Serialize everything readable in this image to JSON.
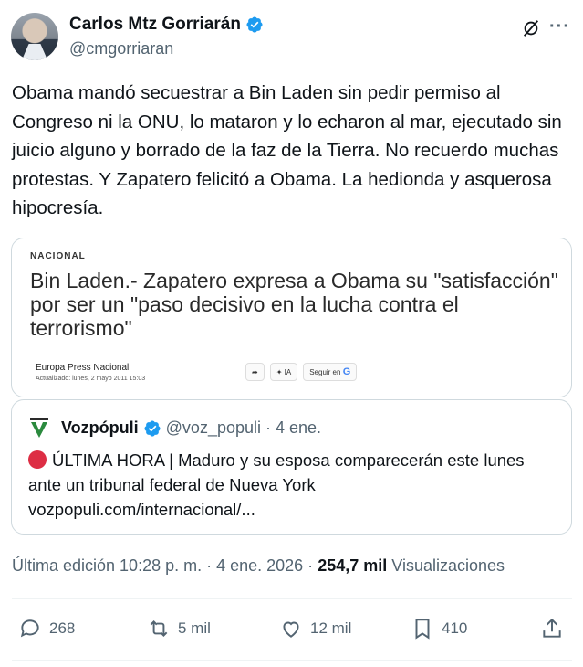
{
  "author": {
    "name": "Carlos Mtz Gorriarán",
    "handle": "@cmgorriaran"
  },
  "tweet": {
    "text": "Obama mandó secuestrar a Bin Laden sin pedir permiso al Congreso ni la ONU, lo mataron y lo echaron al mar, ejecutado sin juicio alguno y borrado de la faz de la Tierra. No recuerdo muchas protestas. Y Zapatero felicitó a Obama. La hedionda y asquerosa hipocresía."
  },
  "image_card": {
    "section": "NACIONAL",
    "headline": "Bin Laden.- Zapatero expresa a Obama su \"satisfacción\" por ser un \"paso decisivo en la lucha contra el terrorismo\"",
    "source": "Europa Press Nacional",
    "updated": "Actualizado: lunes, 2 mayo 2011 15:03",
    "btn_ia": "IA",
    "btn_follow": "Seguir en"
  },
  "quote": {
    "name": "Vozpópuli",
    "handle": "@voz_populi",
    "date": "· 4 ene.",
    "line1": "ÚLTIMA HORA | Maduro y su esposa comparecerán este lunes ante un tribunal federal de Nueva York",
    "link": "vozpopuli.com/internacional/..."
  },
  "meta": {
    "edited": "Última edición 10:28 p. m. · 4 ene. 2026 ·",
    "views_count": "254,7 mil",
    "views_label": "Visualizaciones"
  },
  "actions": {
    "replies": "268",
    "reposts": "5 mil",
    "likes": "12 mil",
    "bookmarks": "410"
  },
  "colors": {
    "verified": "#1d9bf0",
    "muted": "#536471",
    "border": "#cfd9de",
    "alert": "#dd2e44"
  }
}
